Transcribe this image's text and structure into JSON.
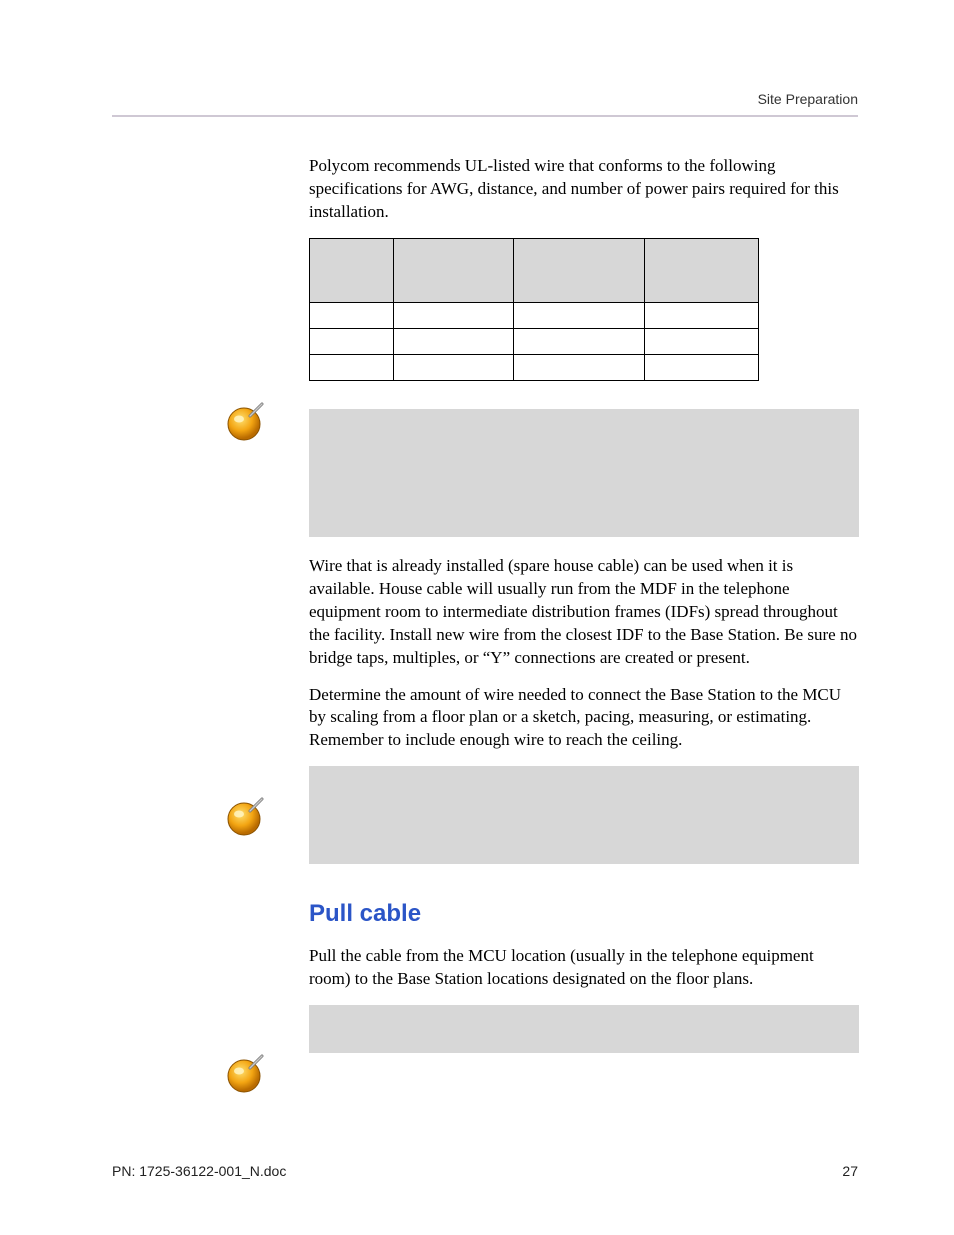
{
  "header": {
    "section_title": "Site Preparation"
  },
  "body": {
    "para_intro": "Polycom recommends UL-listed wire that conforms to the following specifications for AWG, distance, and number of power pairs required for this installation.",
    "table": {
      "headers": [
        "",
        "",
        "",
        ""
      ],
      "rows": [
        [
          "",
          "",
          "",
          ""
        ],
        [
          "",
          "",
          "",
          ""
        ],
        [
          "",
          "",
          "",
          ""
        ]
      ]
    },
    "para_house_cable": "Wire that is already installed (spare house cable) can be used when it is available. House cable will usually run from the MDF in the telephone equipment room to intermediate distribution frames (IDFs) spread throughout the facility. Install new wire from the closest IDF to the Base Station. Be sure no bridge taps, multiples, or “Y” connections are created or present.",
    "para_determine_wire": "Determine the amount of wire needed to connect the Base Station to the MCU by scaling from a floor plan or a sketch, pacing, measuring, or estimating. Remember to include enough wire to reach the ceiling.",
    "heading_pull_cable": "Pull cable",
    "para_pull_cable": "Pull the cable from the MCU location (usually in the telephone equipment room) to the Base Station locations designated on the floor plans."
  },
  "icons": {
    "note_icon_label": "note-thumbtack-icon"
  },
  "footer": {
    "doc_id": "PN: 1725-36122-001_N.doc",
    "page_number": "27"
  }
}
